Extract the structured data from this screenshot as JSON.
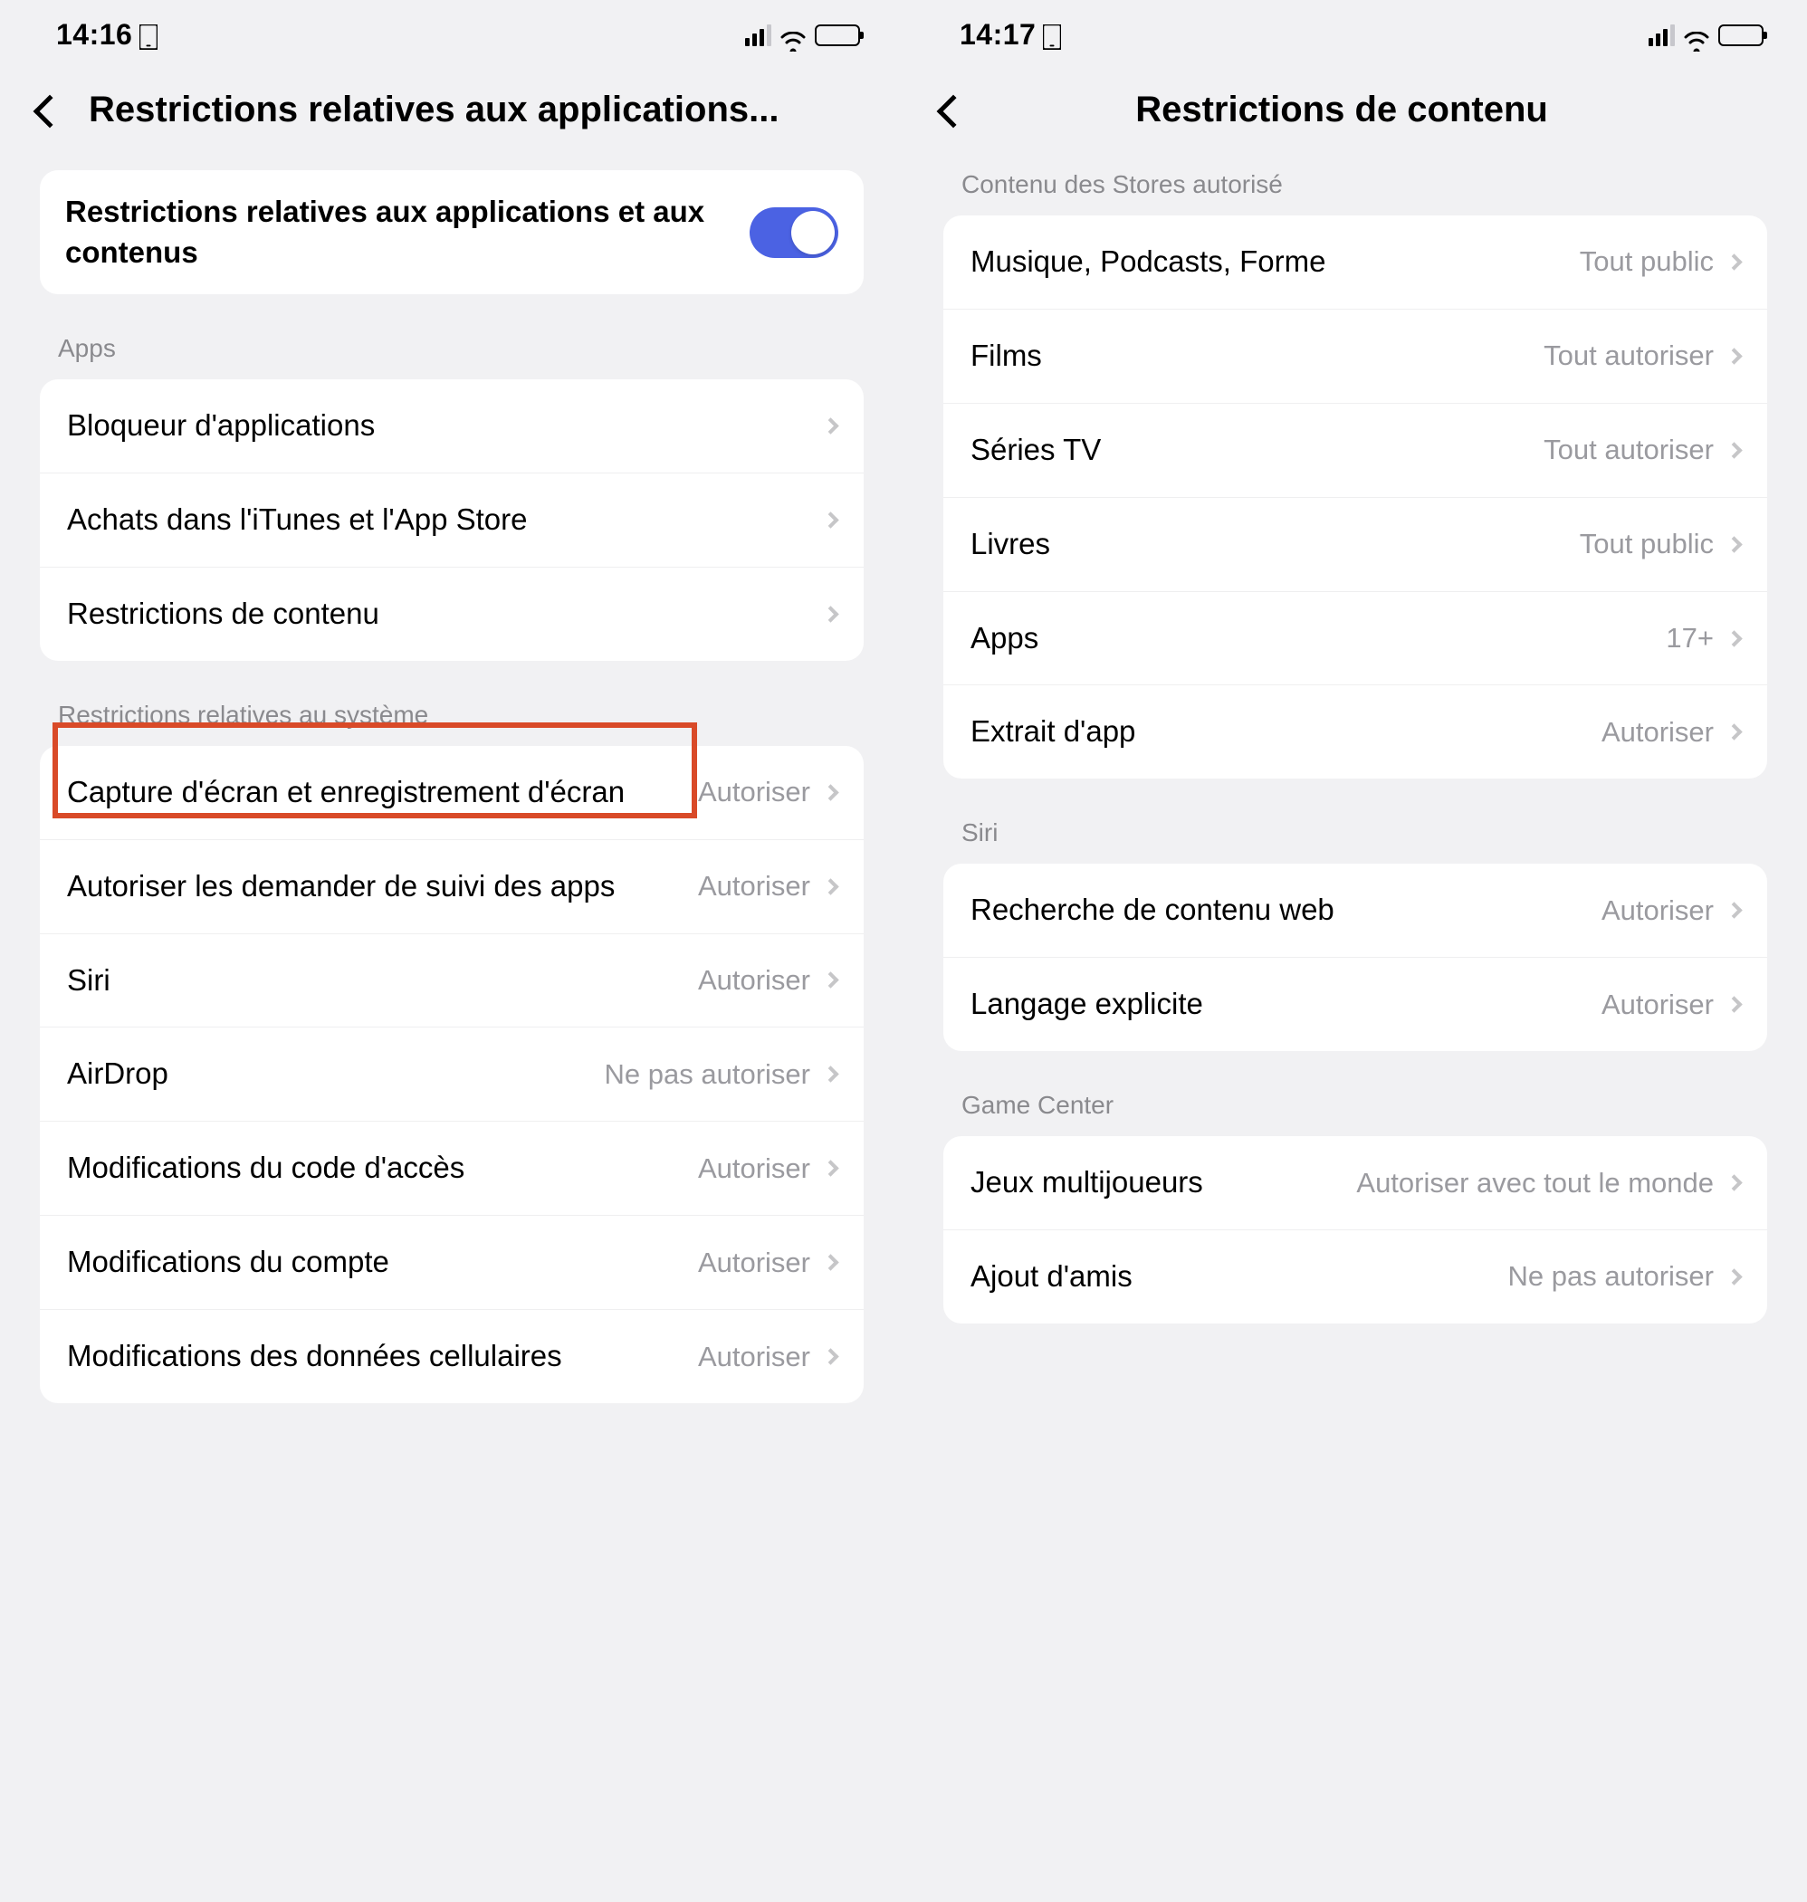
{
  "screen1": {
    "status": {
      "time": "14:16"
    },
    "title": "Restrictions relatives aux applications...",
    "toggle": {
      "label": "Restrictions relatives aux applications et aux contenus"
    },
    "sections": {
      "apps": {
        "header": "Apps",
        "items": [
          {
            "label": "Bloqueur d'applications"
          },
          {
            "label": "Achats dans l'iTunes et l'App Store"
          },
          {
            "label": "Restrictions de contenu"
          }
        ]
      },
      "system": {
        "header": "Restrictions relatives au système",
        "items": [
          {
            "label": "Capture d'écran et enregistrement d'écran",
            "value": "Autoriser"
          },
          {
            "label": "Autoriser les demander de suivi des apps",
            "value": "Autoriser"
          },
          {
            "label": "Siri",
            "value": "Autoriser"
          },
          {
            "label": "AirDrop",
            "value": "Ne pas autoriser"
          },
          {
            "label": "Modifications du code d'accès",
            "value": "Autoriser"
          },
          {
            "label": "Modifications du compte",
            "value": "Autoriser"
          },
          {
            "label": "Modifications des données cellulaires",
            "value": "Autoriser"
          }
        ]
      }
    }
  },
  "screen2": {
    "status": {
      "time": "14:17"
    },
    "title": "Restrictions de contenu",
    "sections": {
      "store": {
        "header": "Contenu des Stores autorisé",
        "items": [
          {
            "label": "Musique, Podcasts, Forme",
            "value": "Tout public"
          },
          {
            "label": "Films",
            "value": "Tout autoriser"
          },
          {
            "label": "Séries TV",
            "value": "Tout autoriser"
          },
          {
            "label": "Livres",
            "value": "Tout public"
          },
          {
            "label": "Apps",
            "value": "17+"
          },
          {
            "label": "Extrait d'app",
            "value": "Autoriser"
          }
        ]
      },
      "siri": {
        "header": "Siri",
        "items": [
          {
            "label": "Recherche de contenu web",
            "value": "Autoriser"
          },
          {
            "label": "Langage explicite",
            "value": "Autoriser"
          }
        ]
      },
      "game": {
        "header": "Game Center",
        "items": [
          {
            "label": "Jeux multijoueurs",
            "value": "Autoriser avec tout le monde"
          },
          {
            "label": "Ajout d'amis",
            "value": "Ne pas autoriser"
          }
        ]
      }
    }
  }
}
